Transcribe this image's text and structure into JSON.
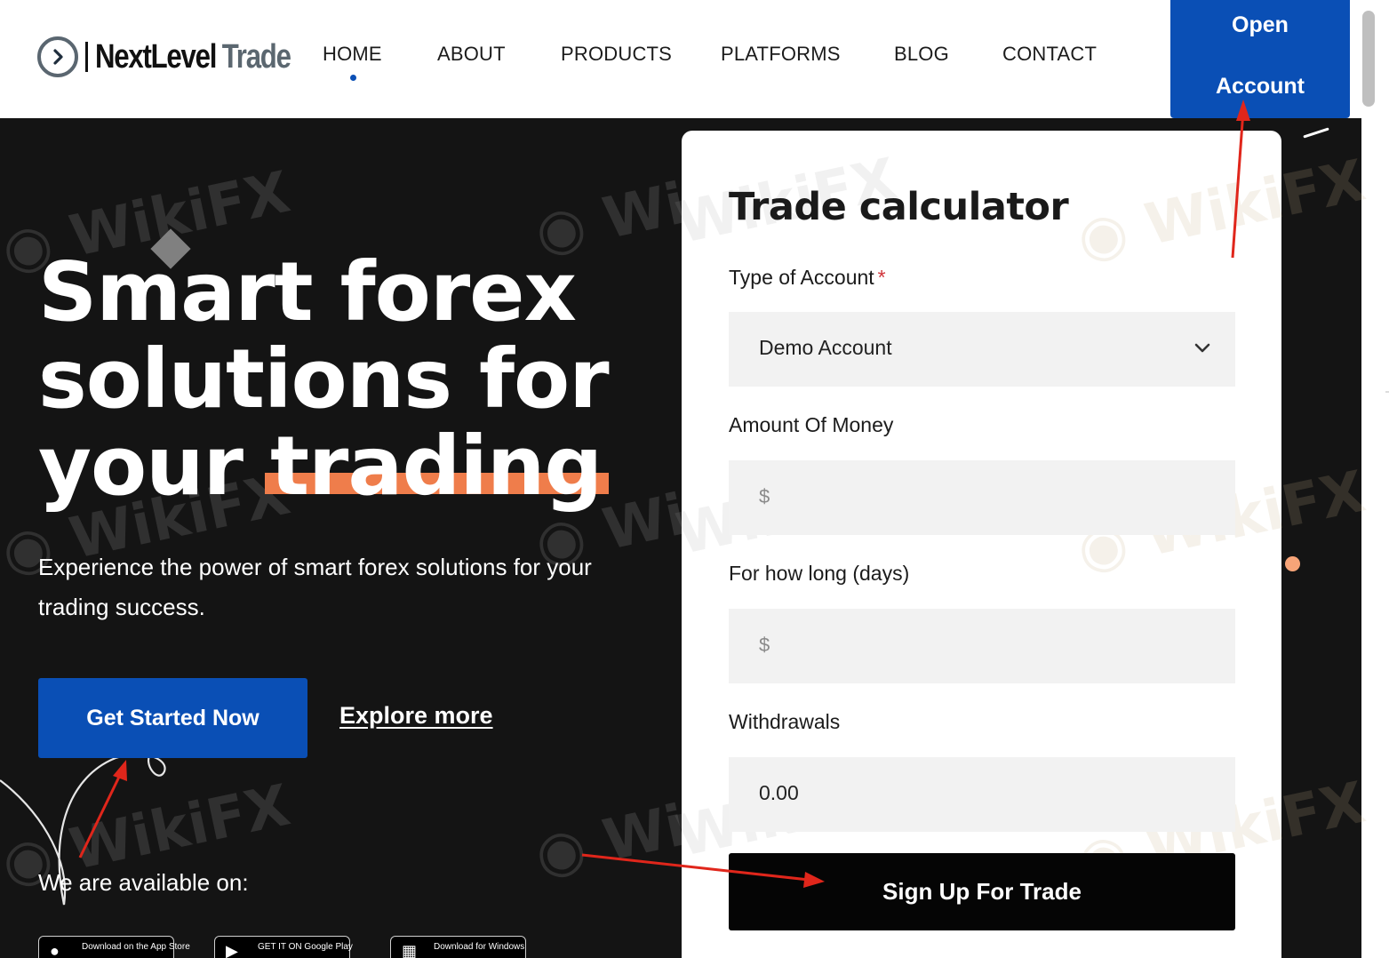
{
  "header": {
    "logo": {
      "part1": "NextLevel",
      "part2": "Trade"
    },
    "nav": [
      {
        "label": "HOME",
        "active": true
      },
      {
        "label": "ABOUT"
      },
      {
        "label": "PRODUCTS"
      },
      {
        "label": "PLATFORMS"
      },
      {
        "label": "BLOG"
      },
      {
        "label": "CONTACT"
      }
    ],
    "open_account": {
      "line1": "Open",
      "line2": "Account"
    }
  },
  "hero": {
    "title_line1": "Smart forex",
    "title_line2": "solutions for",
    "title_line3_prefix": "your",
    "title_line3_highlight": "trading",
    "subtitle": "Experience the power of smart forex solutions for your trading success.",
    "cta_primary": "Get Started Now",
    "cta_secondary": "Explore more",
    "available_label": "We are available on:",
    "stores": [
      {
        "label": "Download on the App Store",
        "icon": "apple-icon"
      },
      {
        "label": "GET IT ON Google Play",
        "icon": "google-play-icon"
      },
      {
        "label": "Download for Windows",
        "icon": "windows-icon"
      }
    ]
  },
  "calculator": {
    "title": "Trade calculator",
    "account_type_label": "Type of Account",
    "required_mark": "*",
    "account_type_value": "Demo Account",
    "amount_label": "Amount Of Money",
    "amount_placeholder": "$",
    "duration_label": "For how long (days)",
    "duration_placeholder": "$",
    "withdrawals_label": "Withdrawals",
    "withdrawals_value": "0.00",
    "submit_label": "Sign Up For Trade"
  },
  "watermark": "WikiFX",
  "colors": {
    "brand_blue": "#0a4fb5",
    "hero_bg": "#141414",
    "accent_orange": "#ef7d4b",
    "annotation_red": "#e0261b"
  }
}
